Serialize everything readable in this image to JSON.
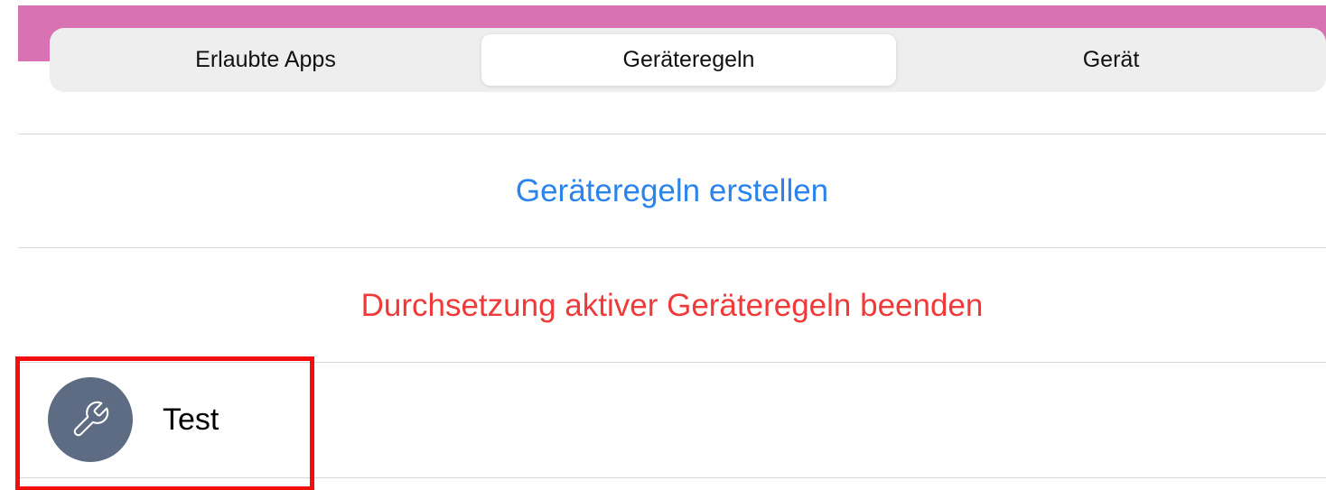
{
  "header": {
    "accent_color": "#d872b2"
  },
  "tabs": [
    {
      "label": "Erlaubte Apps",
      "selected": false
    },
    {
      "label": "Geräteregeln",
      "selected": true
    },
    {
      "label": "Gerät",
      "selected": false
    }
  ],
  "actions": {
    "create_label": "Geräteregeln erstellen",
    "create_color": "#2a84ec",
    "stop_label": "Durchsetzung aktiver Geräteregeln beenden",
    "stop_color": "#f03a3a"
  },
  "rules": [
    {
      "name": "Test",
      "icon": "wrench-icon"
    }
  ],
  "highlight": {
    "color": "#f40d0d"
  }
}
